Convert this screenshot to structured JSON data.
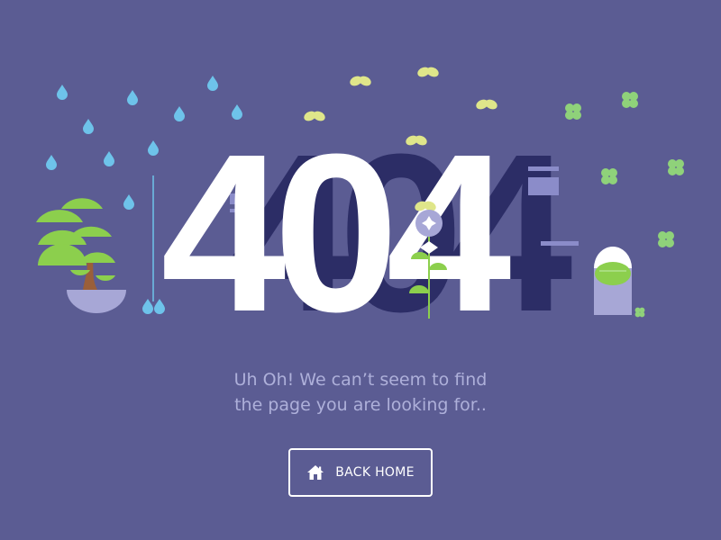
{
  "hero": {
    "code": "404",
    "shadow_code": "404"
  },
  "message": {
    "line1": "Uh Oh!  We can’t seem to find",
    "line2": "the page you are looking for.."
  },
  "back_button": {
    "label": "BACK HOME",
    "icon": "home-icon"
  },
  "colors": {
    "background": "#5b5c93",
    "shadow_digits": "#2c2d66",
    "digit_stripe": "#8b8cc9",
    "front_digits": "#ffffff",
    "message_text": "#aeb0da",
    "raindrop": "#6ec3ea",
    "leaf_yellow": "#dfe68a",
    "clover_green": "#8fd27a",
    "tree_green": "#8ccf4d",
    "tree_trunk": "#9a5f3a",
    "pot": "#a7a7d6"
  },
  "decorations": [
    "raindrop-icon",
    "butterfly-leaf-icon",
    "clover-icon",
    "bonsai-tree",
    "flower",
    "lamp"
  ]
}
